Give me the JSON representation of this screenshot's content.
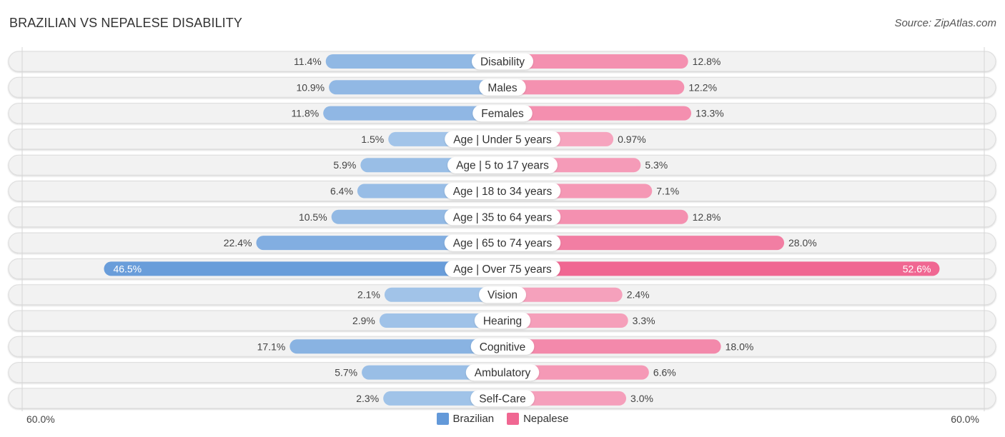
{
  "header": {
    "title": "BRAZILIAN VS NEPALESE DISABILITY",
    "source": "Source: ZipAtlas.com"
  },
  "colors": {
    "brazilian": "#6399d9",
    "brazilian_light": "#a8c8ea",
    "nepalese": "#f06792",
    "nepalese_light": "#f6a8c1",
    "track": "#f2f2f2"
  },
  "axis": {
    "left_label": "60.0%",
    "right_label": "60.0%"
  },
  "legend": [
    {
      "name": "Brazilian",
      "color": "#6399d9"
    },
    {
      "name": "Nepalese",
      "color": "#f06792"
    }
  ],
  "chart_data": {
    "type": "bar",
    "orientation": "horizontal-diverging",
    "title": "BRAZILIAN VS NEPALESE DISABILITY",
    "xlim": [
      0,
      60
    ],
    "x_unit": "%",
    "grid": false,
    "legend_position": "bottom-center",
    "categories": [
      "Disability",
      "Males",
      "Females",
      "Age | Under 5 years",
      "Age | 5 to 17 years",
      "Age | 18 to 34 years",
      "Age | 35 to 64 years",
      "Age | 65 to 74 years",
      "Age | Over 75 years",
      "Vision",
      "Hearing",
      "Cognitive",
      "Ambulatory",
      "Self-Care"
    ],
    "series": [
      {
        "name": "Brazilian",
        "side": "left",
        "values": [
          11.4,
          10.9,
          11.8,
          1.5,
          5.9,
          6.4,
          10.5,
          22.4,
          46.5,
          2.1,
          2.9,
          17.1,
          5.7,
          2.3
        ],
        "labels": [
          "11.4%",
          "10.9%",
          "11.8%",
          "1.5%",
          "5.9%",
          "6.4%",
          "10.5%",
          "22.4%",
          "46.5%",
          "2.1%",
          "2.9%",
          "17.1%",
          "5.7%",
          "2.3%"
        ]
      },
      {
        "name": "Nepalese",
        "side": "right",
        "values": [
          12.8,
          12.2,
          13.3,
          0.97,
          5.3,
          7.1,
          12.8,
          28.0,
          52.6,
          2.4,
          3.3,
          18.0,
          6.6,
          3.0
        ],
        "labels": [
          "12.8%",
          "12.2%",
          "13.3%",
          "0.97%",
          "5.3%",
          "7.1%",
          "12.8%",
          "28.0%",
          "52.6%",
          "2.4%",
          "3.3%",
          "18.0%",
          "6.6%",
          "3.0%"
        ]
      }
    ]
  }
}
